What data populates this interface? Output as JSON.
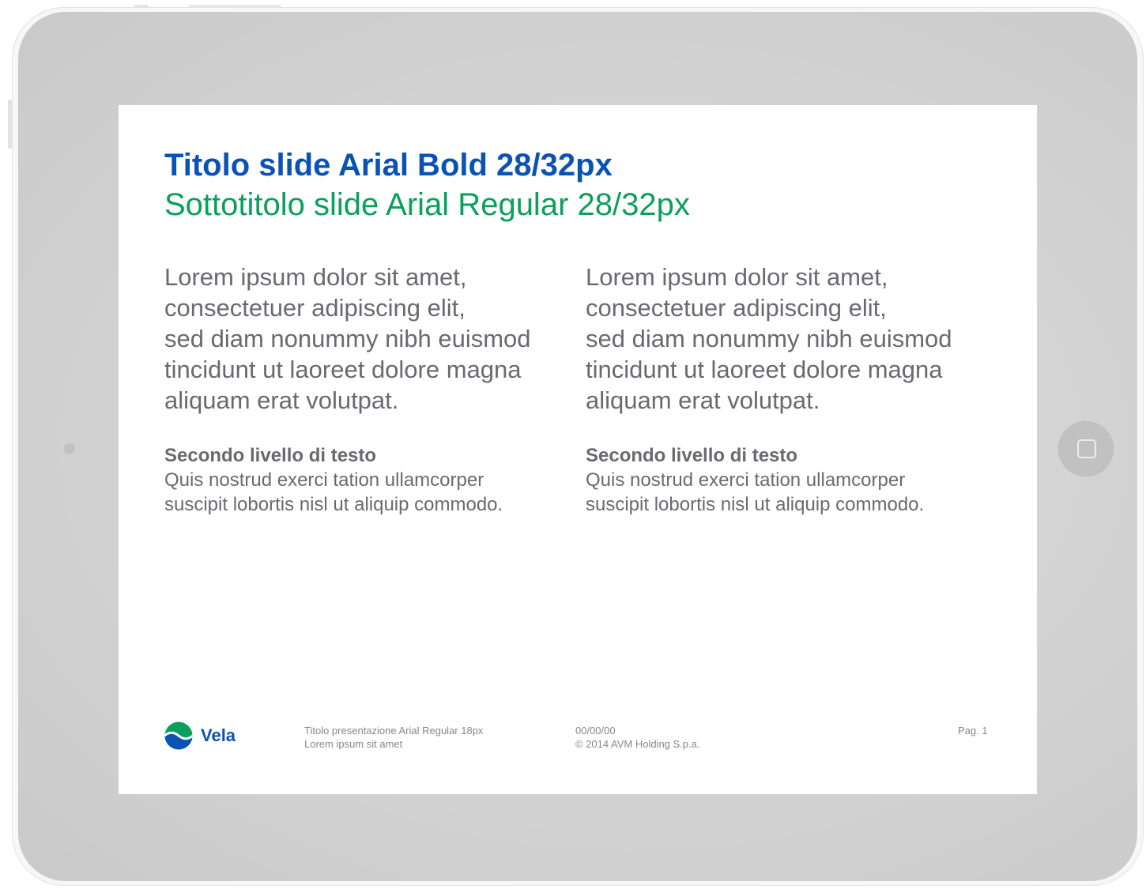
{
  "slide": {
    "title": "Titolo slide Arial Bold 28/32px",
    "subtitle": "Sottotitolo slide Arial Regular 28/32px",
    "columns": [
      {
        "body": "Lorem ipsum dolor sit amet,\nconsectetuer adipiscing elit,\nsed diam nonummy nibh euismod\ntincidunt ut laoreet dolore magna\naliquam erat volutpat.",
        "level2_heading": "Secondo livello di testo",
        "level2_text": "Quis nostrud exerci tation ullamcorper\nsuscipit lobortis nisl ut aliquip commodo."
      },
      {
        "body": "Lorem ipsum dolor sit amet,\nconsectetuer adipiscing elit,\nsed diam nonummy nibh euismod\ntincidunt ut laoreet dolore magna\naliquam erat volutpat.",
        "level2_heading": "Secondo livello di testo",
        "level2_text": "Quis nostrud exerci tation ullamcorper\nsuscipit lobortis nisl ut aliquip commodo."
      }
    ]
  },
  "footer": {
    "logo_text": "Vela",
    "logo_icon": "vela-wave-logo",
    "presentation_title": "Titolo presentazione Arial Regular 18px",
    "presentation_subtitle": "Lorem ipsum sit amet",
    "date": "00/00/00",
    "copyright": "© 2014 AVM Holding S.p.a.",
    "page": "Pag. 1"
  },
  "device": {
    "home_button_icon": "home-square-icon",
    "camera_icon": "front-camera-icon"
  },
  "colors": {
    "title": "#0a53b5",
    "subtitle": "#0aa05b",
    "body_text": "#6d6870",
    "footer_text": "#8a868c",
    "device_frame": "#d3d3d3"
  }
}
